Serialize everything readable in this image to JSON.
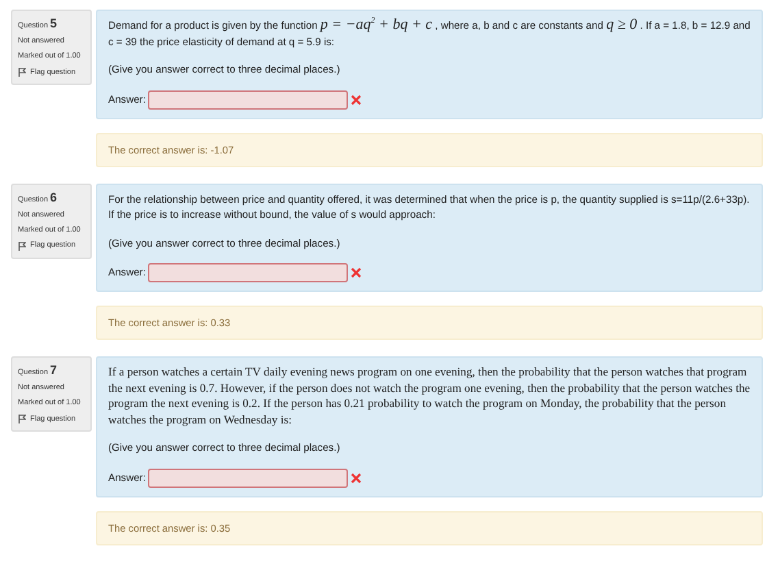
{
  "questions": [
    {
      "label": "Question",
      "number": "5",
      "status": "Not answered",
      "marks": "Marked out of 1.00",
      "flag": "Flag question",
      "prompt": {
        "kind": "sans",
        "parts": [
          {
            "kind": "text",
            "text": "Demand for a product is given by the function "
          },
          {
            "kind": "math",
            "text": "p = −aq$^{2}$ + bq + c"
          },
          {
            "kind": "text",
            "text": " , where a, b and c are constants and "
          },
          {
            "kind": "math",
            "text": "q ≥ 0"
          },
          {
            "kind": "text",
            "text": " . If a = 1.8, b = 12.9 and c = 39 the price elasticity of demand at q = 5.9 is:"
          }
        ]
      },
      "instruction": "(Give you answer correct to three decimal places.)",
      "answer_label": "Answer:",
      "correct": false,
      "feedback": "The correct answer is: -1.07"
    },
    {
      "label": "Question",
      "number": "6",
      "status": "Not answered",
      "marks": "Marked out of 1.00",
      "flag": "Flag question",
      "prompt": {
        "kind": "sans",
        "parts": [
          {
            "kind": "text",
            "text": "For the relationship between price and quantity offered, it was determined that when the price is p, the quantity supplied is s=11p/(2.6+33p)."
          },
          {
            "kind": "break"
          },
          {
            "kind": "text",
            "text": "If the price is to increase without bound, the value of s would approach:"
          }
        ]
      },
      "instruction": "(Give you answer correct to three decimal places.)",
      "answer_label": "Answer:",
      "correct": false,
      "feedback": "The correct answer is: 0.33"
    },
    {
      "label": "Question",
      "number": "7",
      "status": "Not answered",
      "marks": "Marked out of 1.00",
      "flag": "Flag question",
      "prompt": {
        "kind": "serif",
        "parts": [
          {
            "kind": "text",
            "text": "If a person watches a certain TV daily evening news program on one evening, then the probability that the person watches that program the next evening is 0.7. However, if the person does not watch the program one evening, then the probability that the person watches the program the next evening is 0.2. If the person has 0.21 probability to watch the program on Monday, the probability that the person watches the program on Wednesday is:"
          }
        ]
      },
      "instruction": "(Give you answer correct to three decimal places.)",
      "answer_label": "Answer:",
      "correct": false,
      "feedback": "The correct answer is: 0.35"
    }
  ]
}
